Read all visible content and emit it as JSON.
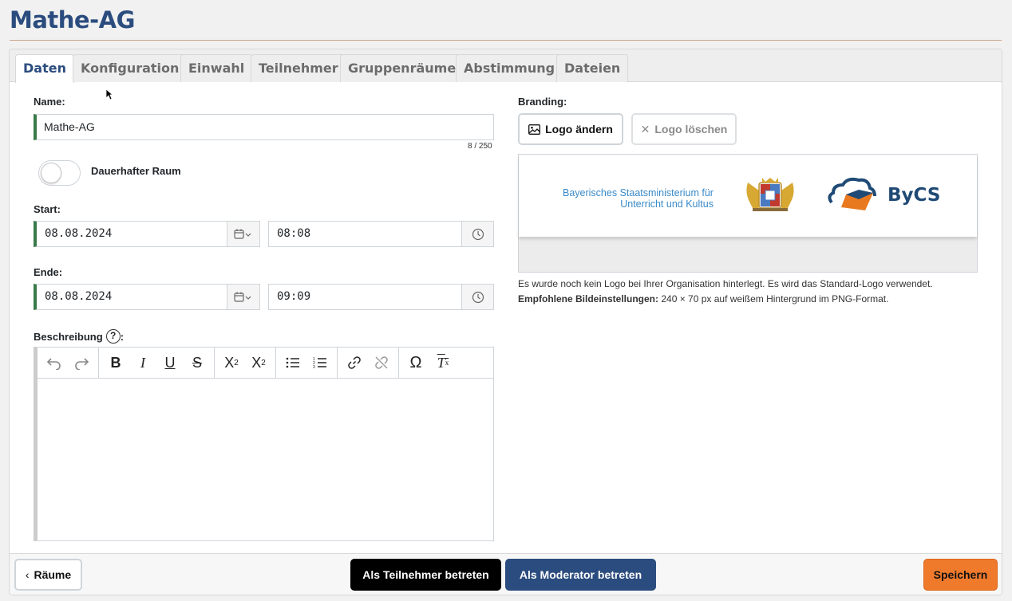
{
  "page": {
    "title": "Mathe-AG"
  },
  "tabs": [
    {
      "label": "Daten"
    },
    {
      "label": "Konfiguration"
    },
    {
      "label": "Einwahl"
    },
    {
      "label": "Teilnehmer"
    },
    {
      "label": "Gruppenräume"
    },
    {
      "label": "Abstimmung"
    },
    {
      "label": "Dateien"
    }
  ],
  "form": {
    "name_label": "Name:",
    "name_value": "Mathe-AG",
    "name_counter": "8 / 250",
    "permanent_label": "Dauerhafter Raum",
    "start_label": "Start:",
    "start_date": "08.08.2024",
    "start_time": "08:08",
    "end_label": "Ende:",
    "end_date": "08.08.2024",
    "end_time": "09:09",
    "description_label": "Beschreibung",
    "description_colon": ":"
  },
  "branding": {
    "label": "Branding:",
    "change_logo": "Logo ändern",
    "delete_logo": "Logo löschen",
    "ministry_line1": "Bayerisches Staatsministerium für",
    "ministry_line2": "Unterricht und Kultus",
    "bycs": "ByCS",
    "note": "Es wurde noch kein Logo bei Ihrer Organisation hinterlegt. Es wird das Standard-Logo verwendet.",
    "recommend_bold": "Empfohlene Bildeinstellungen:",
    "recommend_text": " 240 × 70 px auf weißem Hintergrund im PNG-Format."
  },
  "footer": {
    "back": "Räume",
    "join_participant": "Als Teilnehmer betreten",
    "join_moderator": "Als Moderator betreten",
    "save": "Speichern"
  },
  "colors": {
    "brand": "#2b4c7e",
    "valid": "#3a7a4a",
    "save": "#f07a2c"
  }
}
